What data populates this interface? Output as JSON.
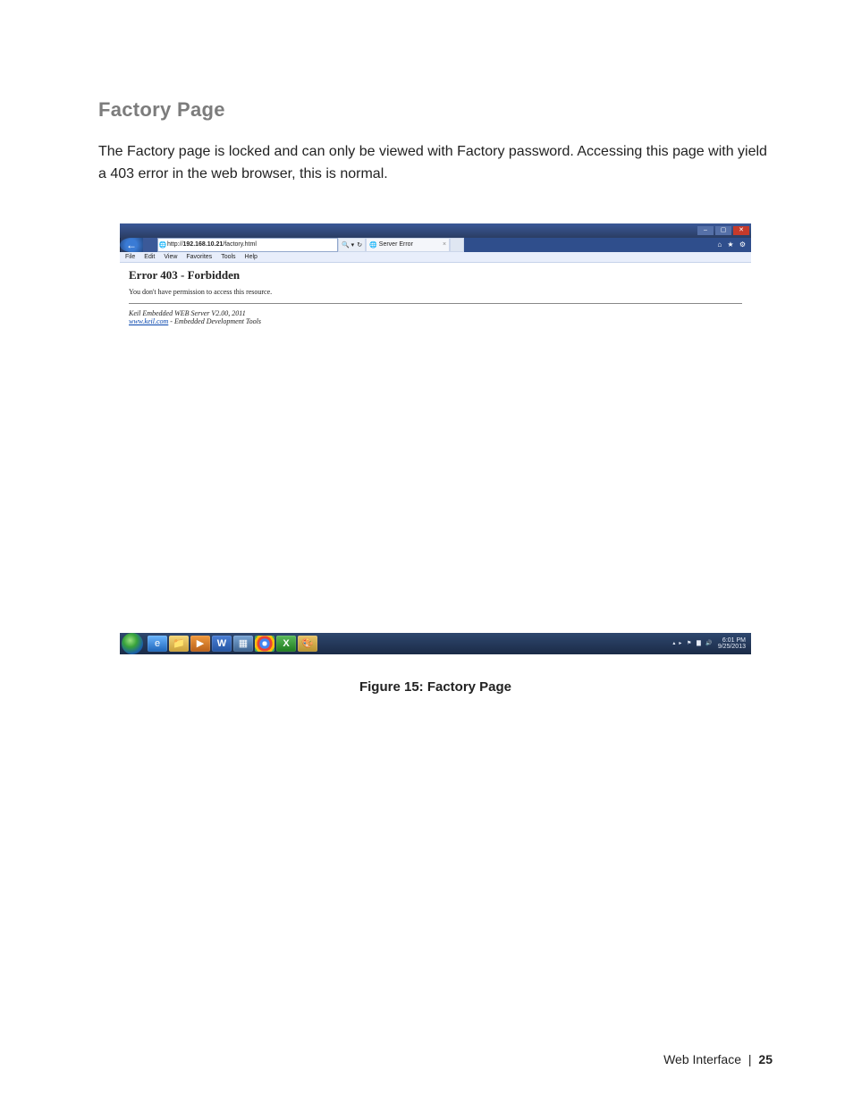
{
  "section_heading": "Factory Page",
  "body_paragraph": "The Factory page is locked and can only be viewed with Factory password.  Accessing this page with yield a 403 error in the web browser, this is normal.",
  "figure_caption": "Figure 15: Factory Page",
  "browser": {
    "address_prefix": "http://",
    "address_host": "192.168.10.21",
    "address_path": "/factory.html",
    "search_glyph": "🔍 ▾",
    "refresh_glyph": "↻",
    "tab_title": "Server Error",
    "tab_close": "×",
    "chrome_right_icons": "⌂ ★ ⚙",
    "menu": [
      "File",
      "Edit",
      "View",
      "Favorites",
      "Tools",
      "Help"
    ],
    "back_arrow": "←"
  },
  "error_page": {
    "heading": "Error 403 - Forbidden",
    "message": "You don't have permission to access this resource.",
    "server_line": "Keil Embedded WEB Server V2.00, 2011",
    "link_text": "www.keil.com",
    "link_tail": " - Embedded Development Tools"
  },
  "taskbar": {
    "icons": {
      "ie": "e",
      "explorer": "📁",
      "wmp": "▶",
      "word": "W",
      "calc": "▦",
      "chrome": "",
      "excel": "X",
      "paint": "🎨"
    },
    "tray_arrow": "▴",
    "tray_icons": "▸ ⚑ ▇ 🔊",
    "clock_time": "6:01 PM",
    "clock_date": "9/25/2013"
  },
  "footer": {
    "label": "Web Interface",
    "separator": "|",
    "page_number": "25"
  }
}
